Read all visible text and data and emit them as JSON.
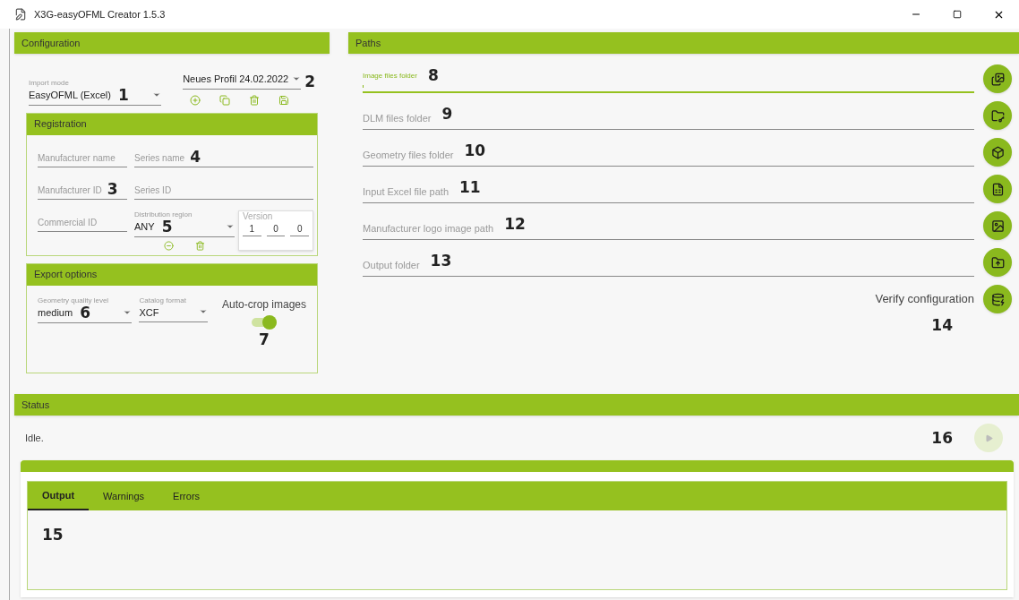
{
  "window": {
    "title": "X3G-easyOFML Creator 1.5.3"
  },
  "configuration": {
    "title": "Configuration",
    "import_mode": {
      "label": "Import mode",
      "value": "EasyOFML (Excel)",
      "marker": "1"
    },
    "profile": {
      "value": "Neues Profil 24.02.2022",
      "marker": "2"
    },
    "registration": {
      "title": "Registration",
      "fields": [
        {
          "placeholder": "Manufacturer name"
        },
        {
          "placeholder": "Series name",
          "marker": "4"
        },
        {
          "placeholder": "Manufacturer ID",
          "marker": "3"
        },
        {
          "placeholder": "Series ID"
        },
        {
          "placeholder": "Commercial ID"
        }
      ],
      "distribution_region": {
        "label": "Distribution region",
        "value": "ANY",
        "marker": "5"
      },
      "version": {
        "label": "Version",
        "values": [
          "1",
          "0",
          "0"
        ]
      }
    },
    "export_options": {
      "title": "Export options",
      "geometry_quality": {
        "label": "Geometry quality level",
        "value": "medium",
        "marker": "6"
      },
      "catalog_format": {
        "label": "Catalog format",
        "value": "XCF"
      },
      "auto_crop": {
        "label": "Auto-crop images",
        "on": true,
        "marker": "7"
      }
    }
  },
  "paths": {
    "title": "Paths",
    "fields": [
      {
        "placeholder": "Image files folder",
        "focused": true,
        "marker": "8",
        "kind": "images"
      },
      {
        "placeholder": "DLM files folder",
        "focused": false,
        "marker": "9",
        "kind": "folder-key"
      },
      {
        "placeholder": "Geometry files folder",
        "focused": false,
        "marker": "10",
        "kind": "cube"
      },
      {
        "placeholder": "Input Excel file path",
        "focused": false,
        "marker": "11",
        "kind": "excel"
      },
      {
        "placeholder": "Manufacturer logo image path",
        "focused": false,
        "marker": "12",
        "kind": "image"
      },
      {
        "placeholder": "Output folder",
        "focused": false,
        "marker": "13",
        "kind": "folder-up"
      }
    ],
    "verify": {
      "label": "Verify configuration",
      "marker": "14"
    }
  },
  "status": {
    "title": "Status",
    "text": "Idle.",
    "run_marker": "16",
    "run_disabled": true,
    "tabs": [
      {
        "label": "Output",
        "selected": true
      },
      {
        "label": "Warnings",
        "selected": false
      },
      {
        "label": "Errors",
        "selected": false
      }
    ],
    "output_marker": "15"
  }
}
